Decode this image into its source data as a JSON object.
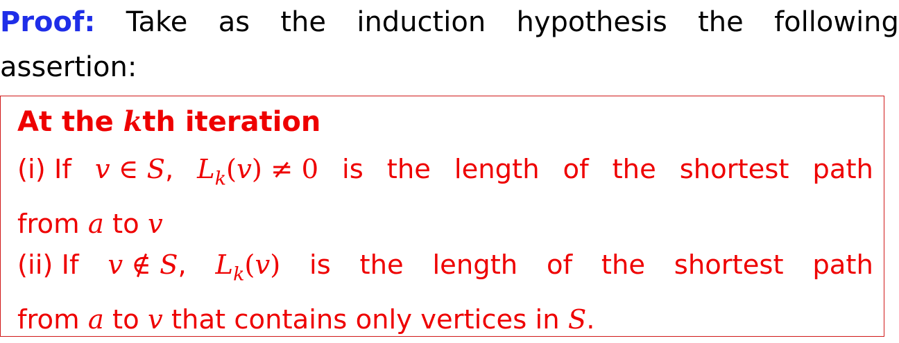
{
  "intro": {
    "label": "Proof:",
    "line1_words": [
      "Take",
      "as",
      "the",
      "induction",
      "hypothesis",
      "the",
      "following"
    ],
    "line2": "assertion:"
  },
  "box": {
    "title_prefix": "At the ",
    "title_var": "k",
    "title_suffix": "th iteration",
    "item1": {
      "lead": "(i) If",
      "cond_v": "v",
      "cond_rel": " ∈ ",
      "cond_set": "S",
      "comma": ",",
      "L": "L",
      "k": "k",
      "arg_open": "(",
      "arg_v": "v",
      "arg_close": ")",
      "neq": " ≠ 0",
      "words": [
        "is",
        "the",
        "length",
        "of",
        "the",
        "shortest",
        "path"
      ],
      "from": "from ",
      "a": "a",
      "to": " to ",
      "v_end": "v"
    },
    "item2": {
      "lead": "(ii) If",
      "cond_v": "v",
      "cond_rel": " ∉ ",
      "cond_set": "S",
      "comma": ",",
      "L": "L",
      "k": "k",
      "arg_open": "(",
      "arg_v": "v",
      "arg_close": ")",
      "words": [
        "is",
        "the",
        "length",
        "of",
        "the",
        "shortest",
        "path"
      ],
      "from": "from ",
      "a": "a",
      "to": " to ",
      "v_mid": "v",
      "rest": " that contains only vertices in ",
      "S_end": "S",
      "period": "."
    }
  },
  "colors": {
    "label_blue": "#1f2ee8",
    "box_red": "#ee0000",
    "text_black": "#000000"
  }
}
